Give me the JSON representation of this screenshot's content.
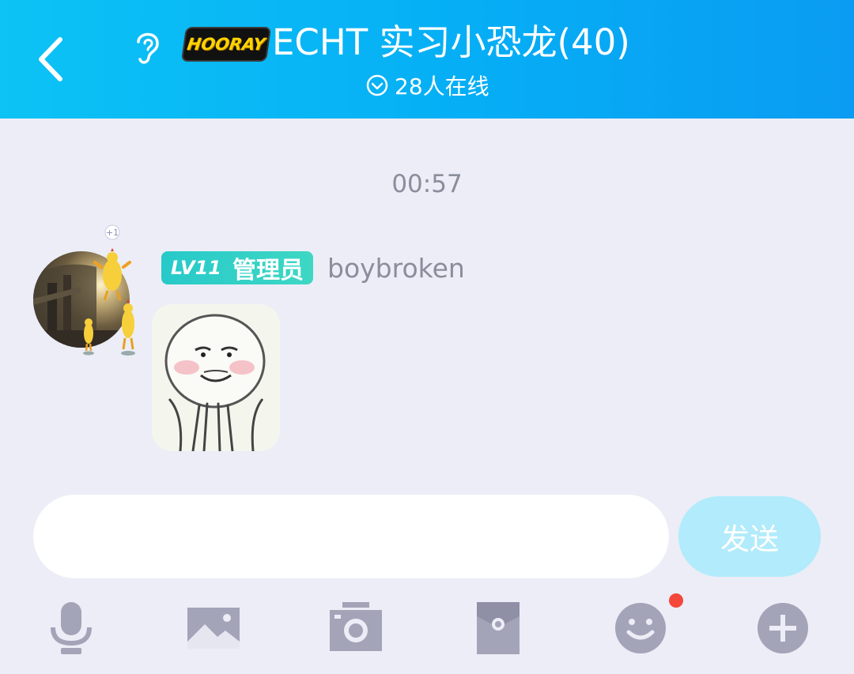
{
  "header": {
    "logo_text": "HOORAY",
    "title": "ECHT 实习小恐龙(40)",
    "online_status": "28人在线"
  },
  "chat": {
    "timestamp": "00:57",
    "messages": [
      {
        "level": "LV11",
        "role": "管理员",
        "sender": "boybroken",
        "content_type": "sticker",
        "avatar_badge": "+1"
      }
    ]
  },
  "composer": {
    "input_value": "",
    "input_placeholder": "",
    "send_label": "发送"
  },
  "toolbar": {
    "items": [
      "microphone-icon",
      "image-icon",
      "camera-icon",
      "red-packet-icon",
      "emoji-icon",
      "plus-icon"
    ],
    "emoji_has_notification": true
  },
  "colors": {
    "header_start": "#0cc3f5",
    "header_end": "#0a9cf2",
    "background": "#ecedf6",
    "send_button": "#b2ebfb",
    "level_badge": "#2fcfc8",
    "toolbar_icon": "#a3a4b8",
    "notification": "#f5473b"
  }
}
